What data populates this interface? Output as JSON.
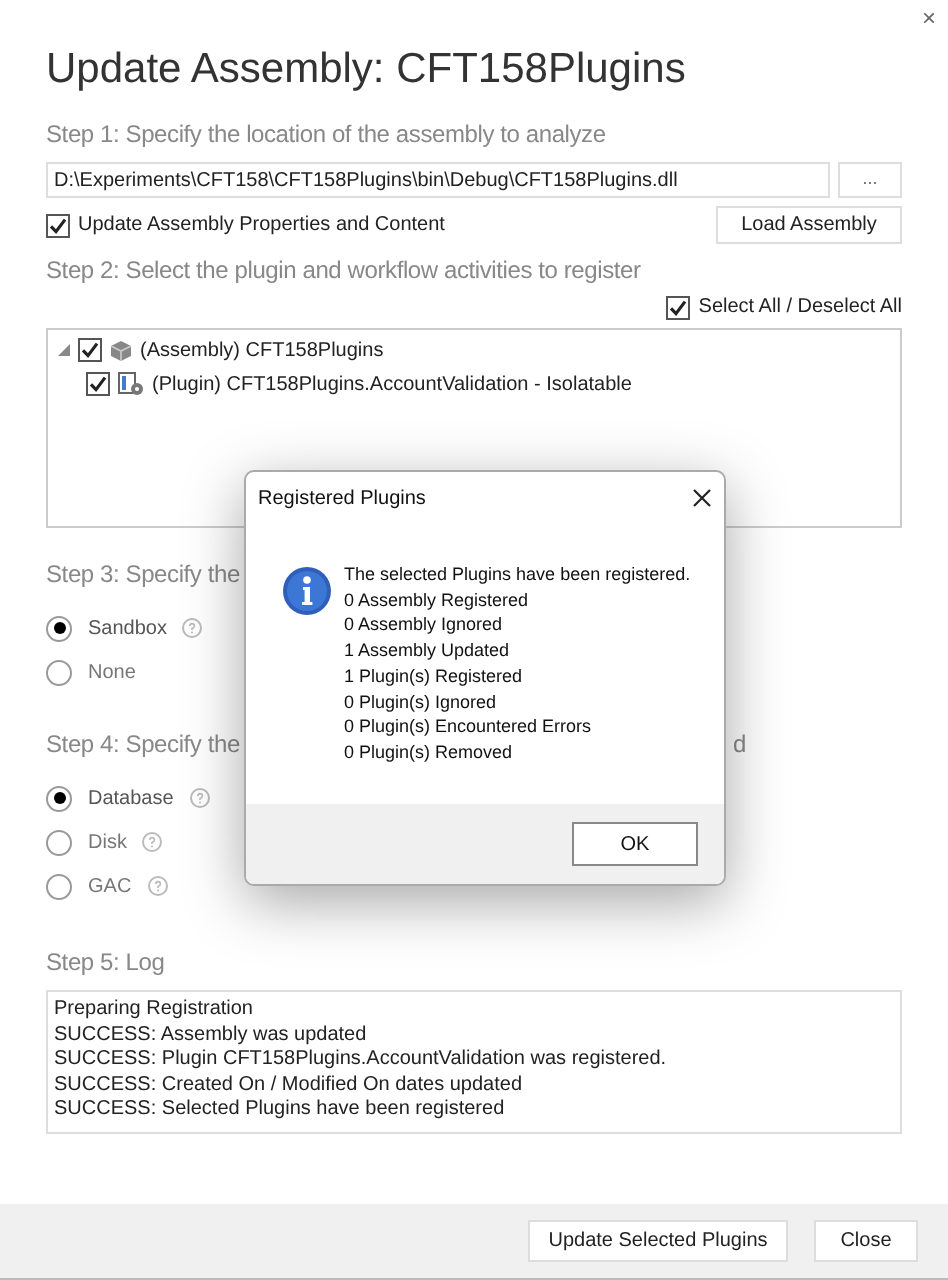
{
  "window": {
    "title": "Update Assembly: CFT158Plugins",
    "close": "×"
  },
  "step1": {
    "heading": "Step 1: Specify the location of the assembly to analyze",
    "path": "D:\\Experiments\\CFT158\\CFT158Plugins\\bin\\Debug\\CFT158Plugins.dll",
    "browse": "...",
    "update_properties": {
      "label": "Update Assembly Properties and Content",
      "checked": true
    },
    "load_button": "Load Assembly"
  },
  "step2": {
    "heading": "Step 2: Select the plugin and workflow activities to register",
    "select_all": {
      "label": "Select All / Deselect All",
      "checked": true
    },
    "tree": [
      {
        "label": "(Assembly) CFT158Plugins",
        "checked": true,
        "expanded": true,
        "kind": "assembly",
        "children": [
          {
            "label": "(Plugin) CFT158Plugins.AccountValidation - Isolatable",
            "checked": true,
            "kind": "plugin"
          }
        ]
      }
    ]
  },
  "step3": {
    "heading": "Step 3: Specify the",
    "options": [
      {
        "label": "Sandbox",
        "selected": true
      },
      {
        "label": "None",
        "selected": false,
        "help": false
      }
    ]
  },
  "step4": {
    "heading": "Step 4: Specify the",
    "heading_tail": "d",
    "options": [
      {
        "label": "Database",
        "selected": true
      },
      {
        "label": "Disk",
        "selected": false
      },
      {
        "label": "GAC",
        "selected": false
      }
    ]
  },
  "step5": {
    "heading": "Step 5: Log",
    "log": [
      "Preparing Registration",
      "SUCCESS: Assembly was updated",
      "SUCCESS: Plugin CFT158Plugins.AccountValidation was registered.",
      "SUCCESS: Created On / Modified On dates updated",
      "SUCCESS: Selected Plugins have been registered"
    ]
  },
  "footer": {
    "buttons": [
      "Update Selected Plugins",
      "Close"
    ]
  },
  "dialog": {
    "title": "Registered Plugins",
    "lines": [
      "The selected Plugins have been registered.",
      "0 Assembly Registered",
      "0 Assembly Ignored",
      "1 Assembly Updated",
      "1 Plugin(s) Registered",
      "0 Plugin(s) Ignored",
      "0 Plugin(s) Encountered Errors",
      "0 Plugin(s) Removed"
    ],
    "ok": "OK"
  }
}
